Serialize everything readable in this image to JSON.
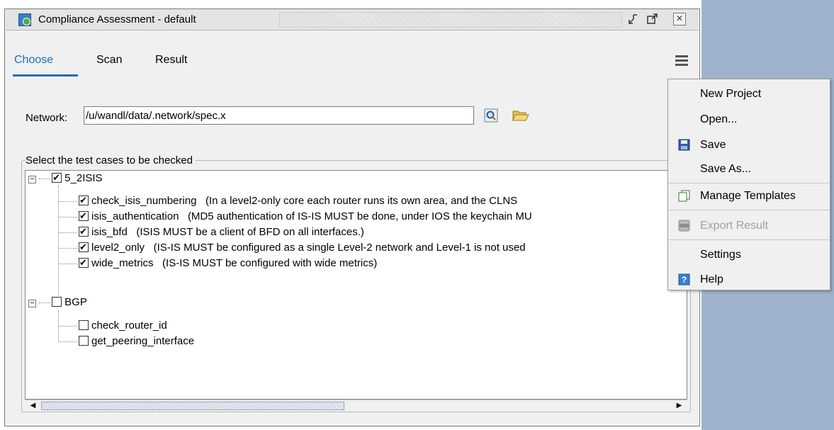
{
  "window": {
    "title": "Compliance Assessment - default",
    "buttons": [
      "minimize",
      "maximize",
      "close"
    ]
  },
  "tabs": [
    {
      "label": "Choose",
      "active": true
    },
    {
      "label": "Scan",
      "active": false
    },
    {
      "label": "Result",
      "active": false
    }
  ],
  "network": {
    "label": "Network:",
    "value": "/u/wandl/data/.network/spec.x"
  },
  "test_group": {
    "label": "Select the test cases to be checked"
  },
  "tree": [
    {
      "label": "5_2ISIS",
      "checked": true,
      "children": [
        {
          "label": "check_isis_numbering",
          "desc": "(In a level2-only core each router runs its own area, and the CLNS",
          "checked": true
        },
        {
          "label": "isis_authentication",
          "desc": "(MD5 authentication of IS-IS MUST be done, under IOS the keychain MU",
          "checked": true
        },
        {
          "label": "isis_bfd",
          "desc": "(ISIS MUST be a client of BFD on all interfaces.)",
          "checked": true
        },
        {
          "label": "level2_only",
          "desc": "(IS-IS MUST be configured as a single Level-2 network and Level-1 is not used",
          "checked": true
        },
        {
          "label": "wide_metrics",
          "desc": "(IS-IS MUST be configured with wide metrics)",
          "checked": true
        }
      ]
    },
    {
      "label": "BGP",
      "checked": false,
      "children": [
        {
          "label": "check_router_id",
          "desc": "",
          "checked": false
        },
        {
          "label": "get_peering_interface",
          "desc": "",
          "checked": false
        }
      ]
    }
  ],
  "menu": {
    "new_project": "New Project",
    "open": "Open...",
    "save": "Save",
    "save_as": "Save As...",
    "manage_templates": "Manage Templates",
    "export_result": "Export Result",
    "settings": "Settings",
    "help": "Help"
  },
  "colors": {
    "accent": "#1f6fb5",
    "desktop": "#9fb3cc"
  }
}
